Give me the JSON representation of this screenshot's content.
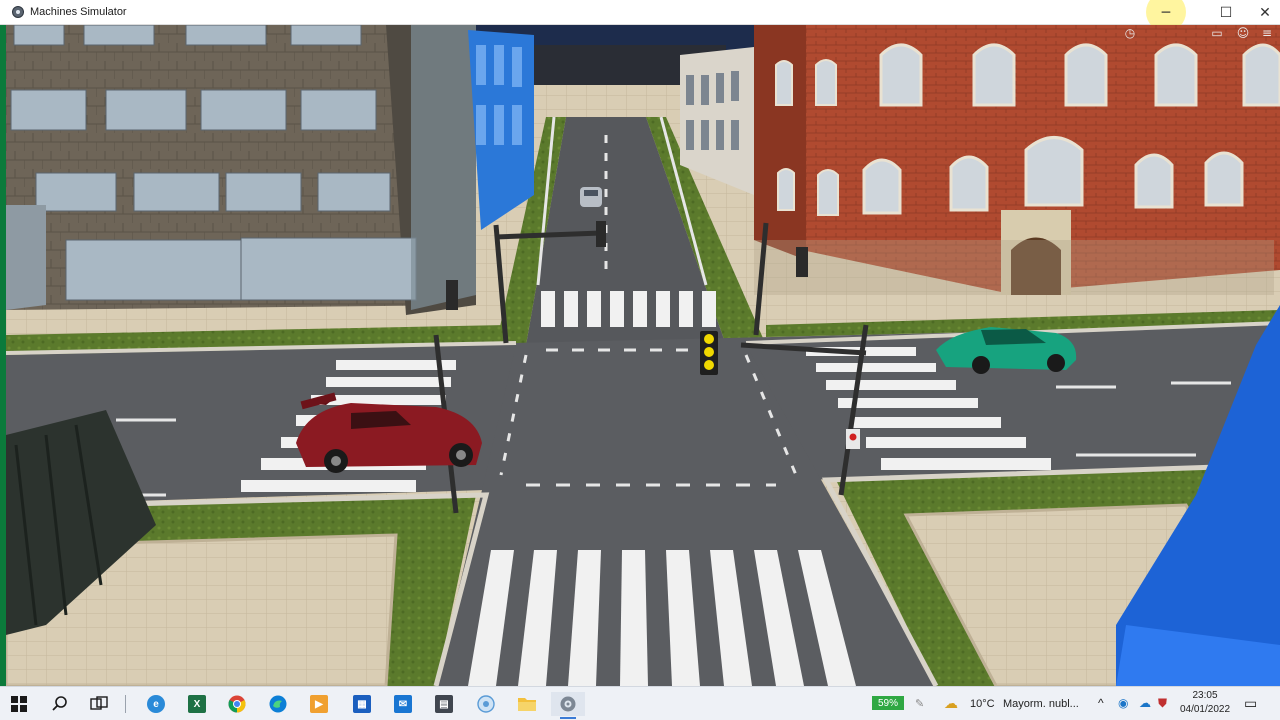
{
  "window": {
    "title": "Machines Simulator"
  },
  "taskbar": {
    "battery_percent": "59%",
    "weather_temp": "10°C",
    "weather_desc": "Mayorm. nubl...",
    "time": "23:05",
    "date": "04/01/2022"
  },
  "colors": {
    "taskbar_bg": "#eef1f6",
    "battery_green": "#2fa843",
    "red_car": "#8b1a22",
    "green_car": "#17a37f",
    "traffic_light_yellow": "#f0d800"
  },
  "icons": [
    "app-icon",
    "minimize-icon",
    "maximize-icon",
    "close-icon",
    "clock-icon",
    "camera-icon",
    "user-icon",
    "menu-icon",
    "windows-start-icon",
    "search-icon",
    "task-view-icon",
    "edge-legacy-icon",
    "excel-icon",
    "chrome-icon",
    "edge-icon",
    "media-player-icon",
    "store-icon",
    "mail-icon",
    "photo-app-icon",
    "circle-app-icon",
    "file-explorer-icon",
    "settings-icon",
    "weather-icon",
    "chevron-up-icon",
    "network-icon",
    "volume-icon",
    "notification-icon"
  ]
}
